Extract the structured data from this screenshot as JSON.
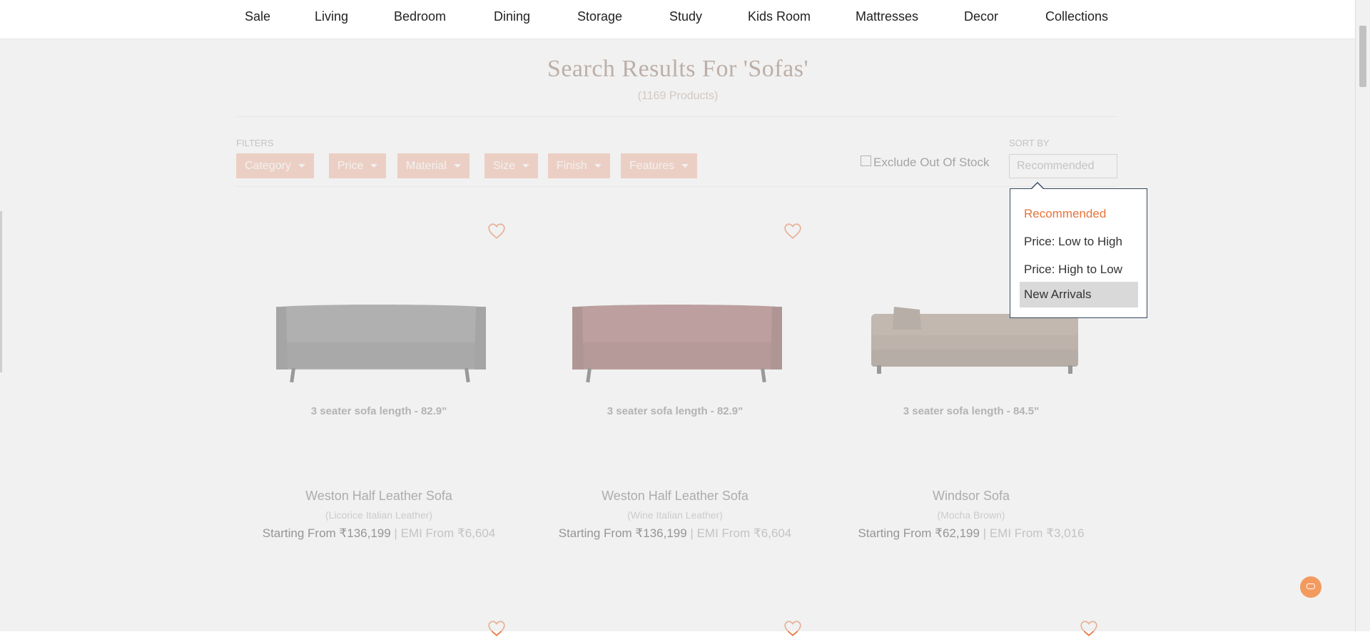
{
  "nav": {
    "items": [
      "Sale",
      "Living",
      "Bedroom",
      "Dining",
      "Storage",
      "Study",
      "Kids Room",
      "Mattresses",
      "Decor",
      "Collections"
    ]
  },
  "search": {
    "title": "Search Results For 'Sofas'",
    "count": "(1169 Products)"
  },
  "filters": {
    "label": "FILTERS",
    "buttons": [
      "Category",
      "Price",
      "Material",
      "Size",
      "Finish",
      "Features"
    ],
    "exclude_label": "Exclude Out Of Stock"
  },
  "sort": {
    "label": "SORT BY",
    "selected": "Recommended",
    "options": [
      "Recommended",
      "Price: Low to High",
      "Price: High to Low",
      "New Arrivals"
    ],
    "highlighted": "New Arrivals"
  },
  "products": [
    {
      "dimension": "3 seater sofa length - 82.9\"",
      "name": "Weston Half Leather Sofa",
      "variant": "(Licorice Italian Leather)",
      "price": "Starting From ₹136,199",
      "emi": " | EMI From ₹6,604",
      "color": "#6f6f6f"
    },
    {
      "dimension": "3 seater sofa length - 82.9\"",
      "name": "Weston Half Leather Sofa",
      "variant": "(Wine Italian Leather)",
      "price": "Starting From ₹136,199",
      "emi": " | EMI From ₹6,604",
      "color": "#8a4b48"
    },
    {
      "dimension": "3 seater sofa length - 84.5\"",
      "name": "Windsor Sofa",
      "variant": "(Mocha Brown)",
      "price": "Starting From ₹62,199",
      "emi": " | EMI From ₹3,016",
      "color": "#8c7565"
    }
  ],
  "colors": {
    "accent": "#e8743b",
    "filter_bg": "#f3b49c",
    "dropdown_border": "#34495e"
  }
}
